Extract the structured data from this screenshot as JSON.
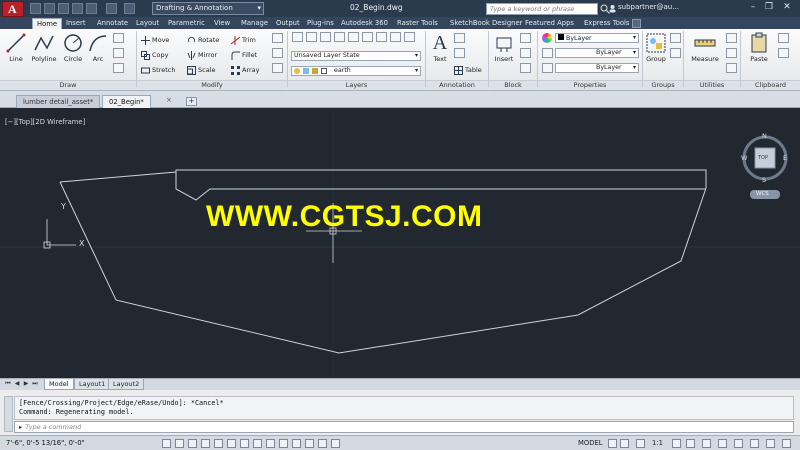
{
  "window": {
    "workspace": "Drafting & Annotation",
    "doc_title": "02_Begin.dwg",
    "search_placeholder": "Type a keyword or phrase",
    "user": "subpartner@au..."
  },
  "ribbon_tabs": [
    "Home",
    "Insert",
    "Annotate",
    "Layout",
    "Parametric",
    "View",
    "Manage",
    "Output",
    "Plug-ins",
    "Autodesk 360",
    "Raster Tools",
    "SketchBook Designer",
    "Featured Apps",
    "Express Tools"
  ],
  "draw": {
    "line": "Line",
    "polyline": "Polyline",
    "circle": "Circle",
    "arc": "Arc",
    "title": "Draw"
  },
  "modify": {
    "move": "Move",
    "rotate": "Rotate",
    "trim": "Trim",
    "copy": "Copy",
    "mirror": "Mirror",
    "fillet": "Fillet",
    "stretch": "Stretch",
    "scale": "Scale",
    "array": "Array",
    "title": "Modify"
  },
  "layers": {
    "layer_state": "Unsaved Layer State",
    "current_layer": "earth",
    "title": "Layers"
  },
  "annotation": {
    "text": "Text",
    "table": "Table",
    "title": "Annotation"
  },
  "block": {
    "insert": "Insert",
    "title": "Block"
  },
  "properties": {
    "color": "ByLayer",
    "linetype": "ByLayer",
    "lineweight": "ByLayer",
    "title": "Properties"
  },
  "groups": {
    "group": "Group",
    "title": "Groups"
  },
  "utilities": {
    "measure": "Measure",
    "title": "Utilities"
  },
  "clipboard": {
    "paste": "Paste",
    "title": "Clipboard"
  },
  "doc_tabs": [
    "lumber detail_asset*",
    "02_Begin*"
  ],
  "viewport": {
    "label": "[−][Top][2D Wireframe]",
    "watermark": "WWW.CGTSJ.COM",
    "compass": {
      "n": "N",
      "s": "S",
      "e": "E",
      "w": "W",
      "top": "TOP",
      "wcs": "WCS"
    },
    "ucs": {
      "x": "X",
      "y": "Y"
    }
  },
  "layout_tabs": [
    "Model",
    "Layout1",
    "Layout2"
  ],
  "command": {
    "history_1": "[Fence/Crossing/Project/Edge/eRase/Undo]: *Cancel*",
    "history_2": "Command:  Regenerating model.",
    "placeholder": "Type a command"
  },
  "status": {
    "coords": "7'-6\",    0'-5 13/16\", 0'-0\"",
    "model": "MODEL",
    "scale": "1:1"
  },
  "colors": {
    "accent_red": "#b8202a",
    "viewport_bg": "#212830",
    "watermark": "#ffff00"
  }
}
